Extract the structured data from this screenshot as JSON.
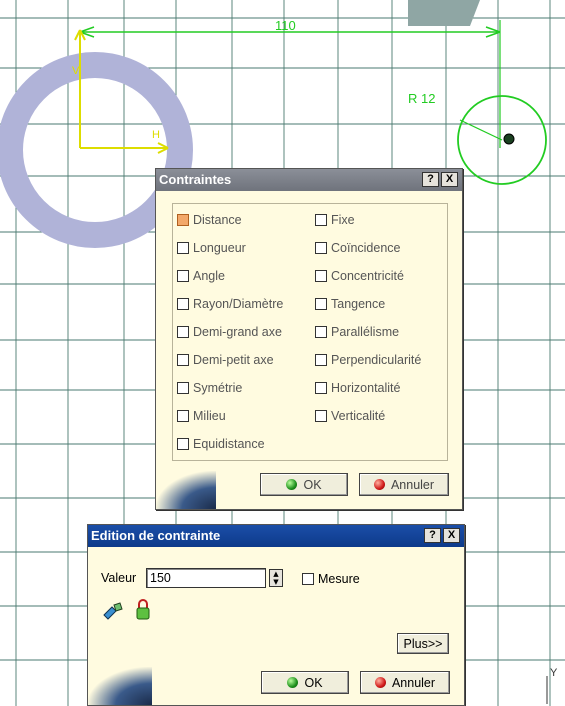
{
  "sketch": {
    "dimension_label": "110",
    "radius_label": "R 12",
    "axis_h_label": "H",
    "axis_v_label": "V",
    "corner_axis_label": "Y",
    "colors": {
      "grid": "#4a7a70",
      "dimension": "#22cc22",
      "axis": "#dddd00",
      "ring": "#b0b3d8",
      "circle": "#22cc22"
    }
  },
  "constraints_dialog": {
    "title": "Contraintes",
    "help_label": "?",
    "close_label": "X",
    "left_column": [
      {
        "label": "Distance",
        "checked": true
      },
      {
        "label": "Longueur",
        "checked": false
      },
      {
        "label": "Angle",
        "checked": false
      },
      {
        "label": "Rayon/Diamètre",
        "checked": false
      },
      {
        "label": "Demi-grand axe",
        "checked": false
      },
      {
        "label": "Demi-petit axe",
        "checked": false
      },
      {
        "label": "Symétrie",
        "checked": false
      },
      {
        "label": "Milieu",
        "checked": false
      },
      {
        "label": "Equidistance",
        "checked": false
      }
    ],
    "right_column": [
      {
        "label": "Fixe",
        "checked": false
      },
      {
        "label": "Coïncidence",
        "checked": false
      },
      {
        "label": "Concentricité",
        "checked": false
      },
      {
        "label": "Tangence",
        "checked": false
      },
      {
        "label": "Parallélisme",
        "checked": false
      },
      {
        "label": "Perpendicularité",
        "checked": false
      },
      {
        "label": "Horizontalité",
        "checked": false
      },
      {
        "label": "Verticalité",
        "checked": false
      }
    ],
    "ok_label": "OK",
    "cancel_label": "Annuler"
  },
  "edit_dialog": {
    "title": "Edition de contrainte",
    "help_label": "?",
    "close_label": "X",
    "value_label": "Valeur",
    "value": "150",
    "measure_label": "Mesure",
    "measure_checked": false,
    "more_label": "Plus>>",
    "ok_label": "OK",
    "cancel_label": "Annuler"
  }
}
